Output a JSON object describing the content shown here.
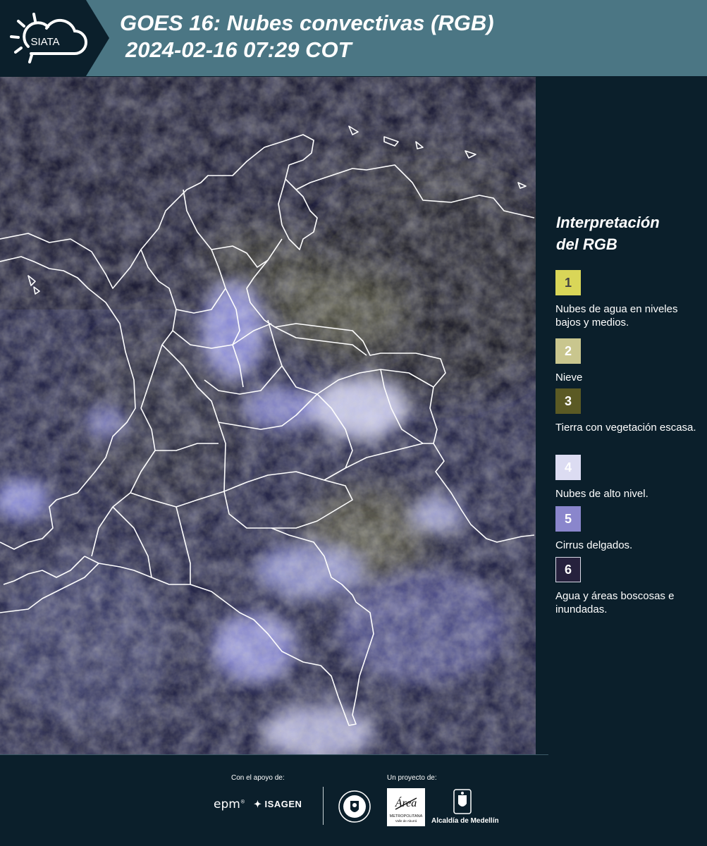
{
  "header": {
    "logo_text": "SIATA",
    "title_line1": "GOES 16: Nubes convectivas (RGB)",
    "title_line2": "2024-02-16 07:29 COT",
    "background_color": "#4b7684"
  },
  "legend": {
    "title_line1": "Interpretación",
    "title_line2": "del RGB",
    "items": [
      {
        "number": "1",
        "label": "Nubes de agua en niveles bajos y medios.",
        "color": "#d9d658"
      },
      {
        "number": "2",
        "label": "Nieve",
        "color": "#c9c68e"
      },
      {
        "number": "3",
        "label": "Tierra con vegetación escasa.",
        "color": "#5b5a24"
      },
      {
        "number": "4",
        "label": "Nubes de alto nivel.",
        "color": "#dcdcf2"
      },
      {
        "number": "5",
        "label": "Cirrus delgados.",
        "color": "#8a86cc"
      },
      {
        "number": "6",
        "label": "Agua y áreas boscosas e inundadas.",
        "color": "#26213d"
      }
    ]
  },
  "footer": {
    "support_label": "Con el apoyo de:",
    "project_label": "Un proyecto de:",
    "epm_text": "epm",
    "isagen_text": "ISAGEN",
    "amva_text": "METROPOLITANA",
    "amva_subtext": "Valle de Aburrá",
    "amva_script": "Área",
    "alcaldia_text": "Alcaldía de Medellín"
  }
}
